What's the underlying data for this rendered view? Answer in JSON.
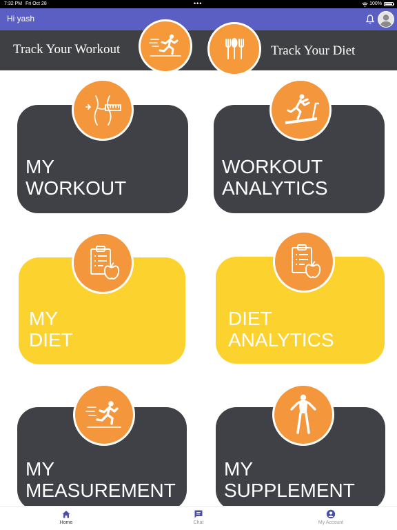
{
  "status_bar": {
    "time": "7:32 PM",
    "date": "Fri Oct 28",
    "battery": "100%"
  },
  "header": {
    "greeting": "Hi yash",
    "color": "#5b5fc4"
  },
  "banner": {
    "left_text": "Track Your Workout",
    "right_text": "Track Your Diet",
    "left_icon": "running-man-icon",
    "right_icon": "fork-spoon-icon"
  },
  "cards": [
    {
      "label": "MY\nWORKOUT",
      "icon": "waist-measure-icon",
      "style": "dark"
    },
    {
      "label": "WORKOUT\nANALYTICS",
      "icon": "treadmill-icon",
      "style": "dark"
    },
    {
      "label": "MY\nDIET",
      "icon": "clipboard-apple-icon",
      "style": "yellow"
    },
    {
      "label": "DIET\nANALYTICS",
      "icon": "clipboard-apple-icon",
      "style": "yellow"
    },
    {
      "label": "MY\nMEASUREMENT",
      "icon": "running-man-icon",
      "style": "dark"
    },
    {
      "label": "MY\nSUPPLEMENT",
      "icon": "bodybuilder-icon",
      "style": "dark"
    }
  ],
  "colors": {
    "dark_card": "#3f4147",
    "yellow_card": "#fcd22f",
    "orange_circle": "#f3963c"
  },
  "bottom_nav": [
    {
      "label": "Home",
      "icon": "home-icon",
      "active": true
    },
    {
      "label": "Chat",
      "icon": "chat-icon",
      "active": false
    },
    {
      "label": "My Account",
      "icon": "account-icon",
      "active": false
    }
  ]
}
